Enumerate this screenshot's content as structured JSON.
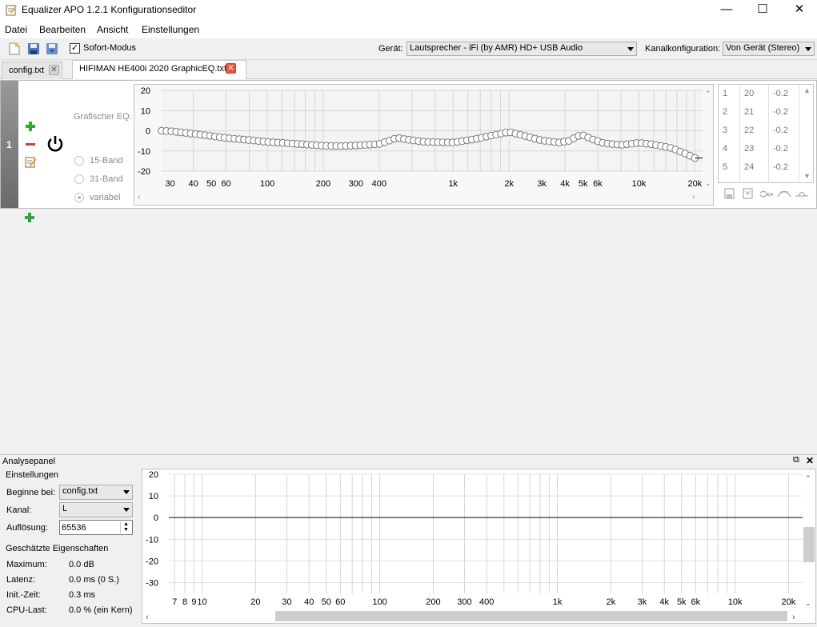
{
  "window": {
    "title": "Equalizer APO 1.2.1 Konfigurationseditor",
    "minimize": "—",
    "maximize": "☐",
    "close": "✕"
  },
  "menu": {
    "items": [
      "Datei",
      "Bearbeiten",
      "Ansicht",
      "Einstellungen"
    ]
  },
  "toolbar": {
    "sofort_label": "Sofort-Modus",
    "sofort_checked": true,
    "device_label": "Gerät:",
    "device_value": "Lautsprecher - iFi (by AMR) HD+ USB Audio",
    "channel_label": "Kanalkonfiguration:",
    "channel_value": "Von Gerät (Stereo)"
  },
  "tabs": [
    {
      "label": "config.txt",
      "active": false
    },
    {
      "label": "HIFIMAN HE400i 2020 GraphicEQ.txt",
      "active": true
    }
  ],
  "filter": {
    "number": "1",
    "type_label": "Grafischer EQ:",
    "options": [
      "15-Band",
      "31-Band",
      "variabel"
    ],
    "selected_option": "variabel",
    "graph": {
      "y_ticks": [
        "20",
        "10",
        "0",
        "-10",
        "-20"
      ],
      "x_ticks": [
        "30",
        "40",
        "50",
        "60",
        "100",
        "200",
        "300",
        "400",
        "1k",
        "2k",
        "3k",
        "4k",
        "5k",
        "6k",
        "10k",
        "20k"
      ]
    },
    "table": [
      {
        "idx": "1",
        "freq": "20",
        "gain": "-0.2"
      },
      {
        "idx": "2",
        "freq": "21",
        "gain": "-0.2"
      },
      {
        "idx": "3",
        "freq": "22",
        "gain": "-0.2"
      },
      {
        "idx": "4",
        "freq": "23",
        "gain": "-0.2"
      },
      {
        "idx": "5",
        "freq": "24",
        "gain": "-0.2"
      }
    ]
  },
  "analysis": {
    "title": "Analysepanel",
    "settings_label": "Einstellungen",
    "start_label": "Beginne bei:",
    "start_value": "config.txt",
    "channel_label": "Kanal:",
    "channel_value": "L",
    "resolution_label": "Auflösung:",
    "resolution_value": "65536",
    "props_label": "Geschätzte Eigenschaften",
    "props": [
      {
        "label": "Maximum:",
        "value": "0.0 dB"
      },
      {
        "label": "Latenz:",
        "value": "0.0 ms (0 S.)"
      },
      {
        "label": "Init.-Zeit:",
        "value": "0.3 ms"
      },
      {
        "label": "CPU-Last:",
        "value": "0.0 % (ein Kern)"
      }
    ],
    "graph": {
      "y_ticks": [
        "20",
        "10",
        "0",
        "-10",
        "-20",
        "-30"
      ],
      "x_ticks": [
        "7",
        "8",
        "9",
        "10",
        "20",
        "30",
        "40",
        "50",
        "60",
        "100",
        "200",
        "300",
        "400",
        "1k",
        "2k",
        "3k",
        "4k",
        "5k",
        "6k",
        "10k",
        "20k"
      ]
    }
  },
  "colors": {
    "accent_close": "#e9563f",
    "green_plus": "#2ea836",
    "red_minus": "#d33c3c"
  },
  "icons": [
    "app-icon",
    "new-file-icon",
    "save-icon",
    "save-as-icon",
    "plus-icon",
    "minus-icon",
    "edit-icon",
    "power-icon"
  ]
}
